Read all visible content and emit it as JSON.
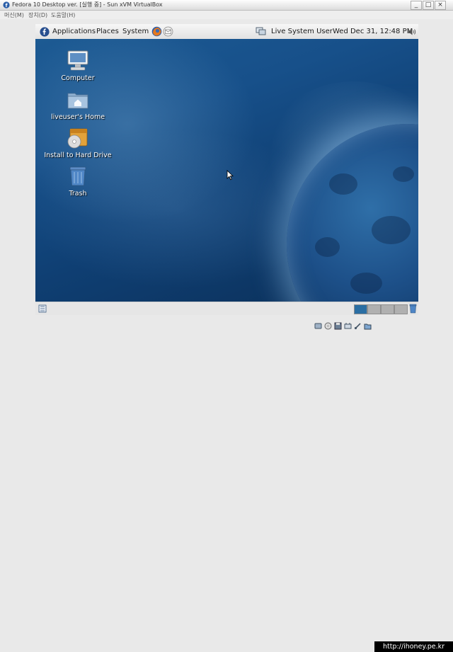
{
  "host": {
    "title": "Fedora 10 Desktop ver. [실행 중] - Sun xVM VirtualBox",
    "menu": [
      "머신(M)",
      "장치(D)",
      "도움말(H)"
    ],
    "window_controls": [
      "_",
      "□",
      "×"
    ]
  },
  "guest_panel": {
    "menus": [
      "Applications",
      "Places",
      "System"
    ],
    "user": "Live System User",
    "clock": "Wed Dec 31, 12:48 PM",
    "launchers": [
      "firefox-icon",
      "mail-icon"
    ]
  },
  "desktop_icons": [
    {
      "label": "Computer",
      "icon": "computer-icon"
    },
    {
      "label": "liveuser's Home",
      "icon": "home-folder-icon"
    },
    {
      "label": "Install to Hard Drive",
      "icon": "installer-icon"
    },
    {
      "label": "Trash",
      "icon": "trash-icon"
    }
  ],
  "workspaces": {
    "count": 4,
    "active": 1
  },
  "colors": {
    "desktop_blue": "#17508a",
    "panel": "#e9e9e9",
    "active_workspace": "#2a6ea3"
  },
  "watermark": "http://ihoney.pe.kr"
}
